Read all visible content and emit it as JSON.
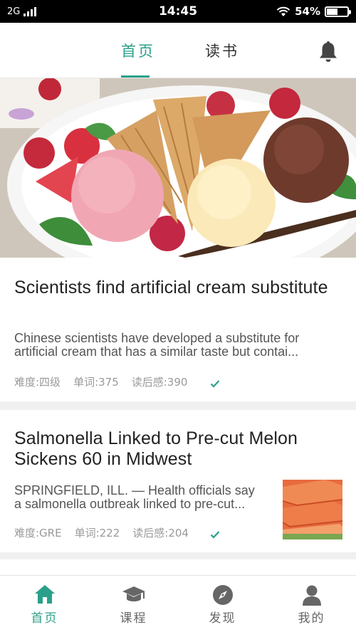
{
  "status_bar": {
    "network": "2G",
    "time": "14:45",
    "battery": "54%",
    "battery_level": 0.54
  },
  "top_nav": {
    "tabs": [
      {
        "label": "首页",
        "active": true
      },
      {
        "label": "读书",
        "active": false
      }
    ],
    "icon": "bell-icon"
  },
  "hero": {
    "icon": "ice-cream-photo"
  },
  "articles": [
    {
      "title": "Scientists find artificial cream substitute",
      "summary_line1": "Chinese scientists have developed a substitute for",
      "summary_line2": "artificial cream that has a similar taste but contai...",
      "difficulty": "难度:四级",
      "words": "单词:375",
      "reviews": "读后感:390",
      "read": true
    },
    {
      "title": "Salmonella Linked to Pre-cut Melon Sickens 60 in Midwest",
      "summary_line1": "SPRINGFIELD, ILL. — Health officials say",
      "summary_line2": "a salmonella outbreak linked to pre-cut...",
      "difficulty": "难度:GRE",
      "words": "单词:222",
      "reviews": "读后感:204",
      "read": true,
      "thumbnail": "melon-photo"
    }
  ],
  "bottom_nav": {
    "items": [
      {
        "label": "首页",
        "icon": "home-icon",
        "active": true
      },
      {
        "label": "课程",
        "icon": "graduation-cap-icon",
        "active": false
      },
      {
        "label": "发现",
        "icon": "compass-icon",
        "active": false
      },
      {
        "label": "我的",
        "icon": "user-icon",
        "active": false
      }
    ]
  },
  "colors": {
    "accent": "#2aa08a",
    "meta_text": "#999999",
    "title_text": "#222222"
  }
}
